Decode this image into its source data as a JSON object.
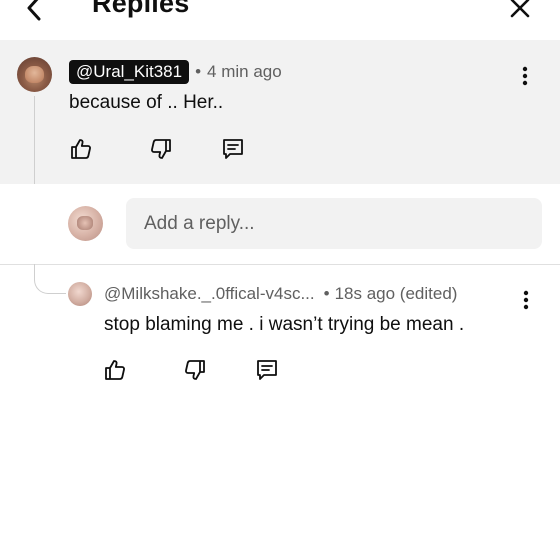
{
  "header": {
    "title": "Replies",
    "back_icon": "chevron-left-icon",
    "close_icon": "close-icon"
  },
  "comment": {
    "author": "@Ural_Kit381",
    "separator": "•",
    "time": "4 min ago",
    "text": "because of .. Her.."
  },
  "reply_input": {
    "placeholder": "Add a reply..."
  },
  "reply": {
    "author": "@Milkshake._.0ffical-v4sc...",
    "separator": "•",
    "time": "18s ago (edited)",
    "text": "stop blaming me . i wasn’t trying be mean ."
  },
  "colors": {
    "background": "#ffffff",
    "comment_bg": "#f2f2f2",
    "secondary_text": "#606060",
    "text": "#0f0f0f"
  },
  "icons": [
    "thumbs-up-icon",
    "thumbs-down-icon",
    "reply-comment-icon",
    "more-vertical-icon"
  ]
}
